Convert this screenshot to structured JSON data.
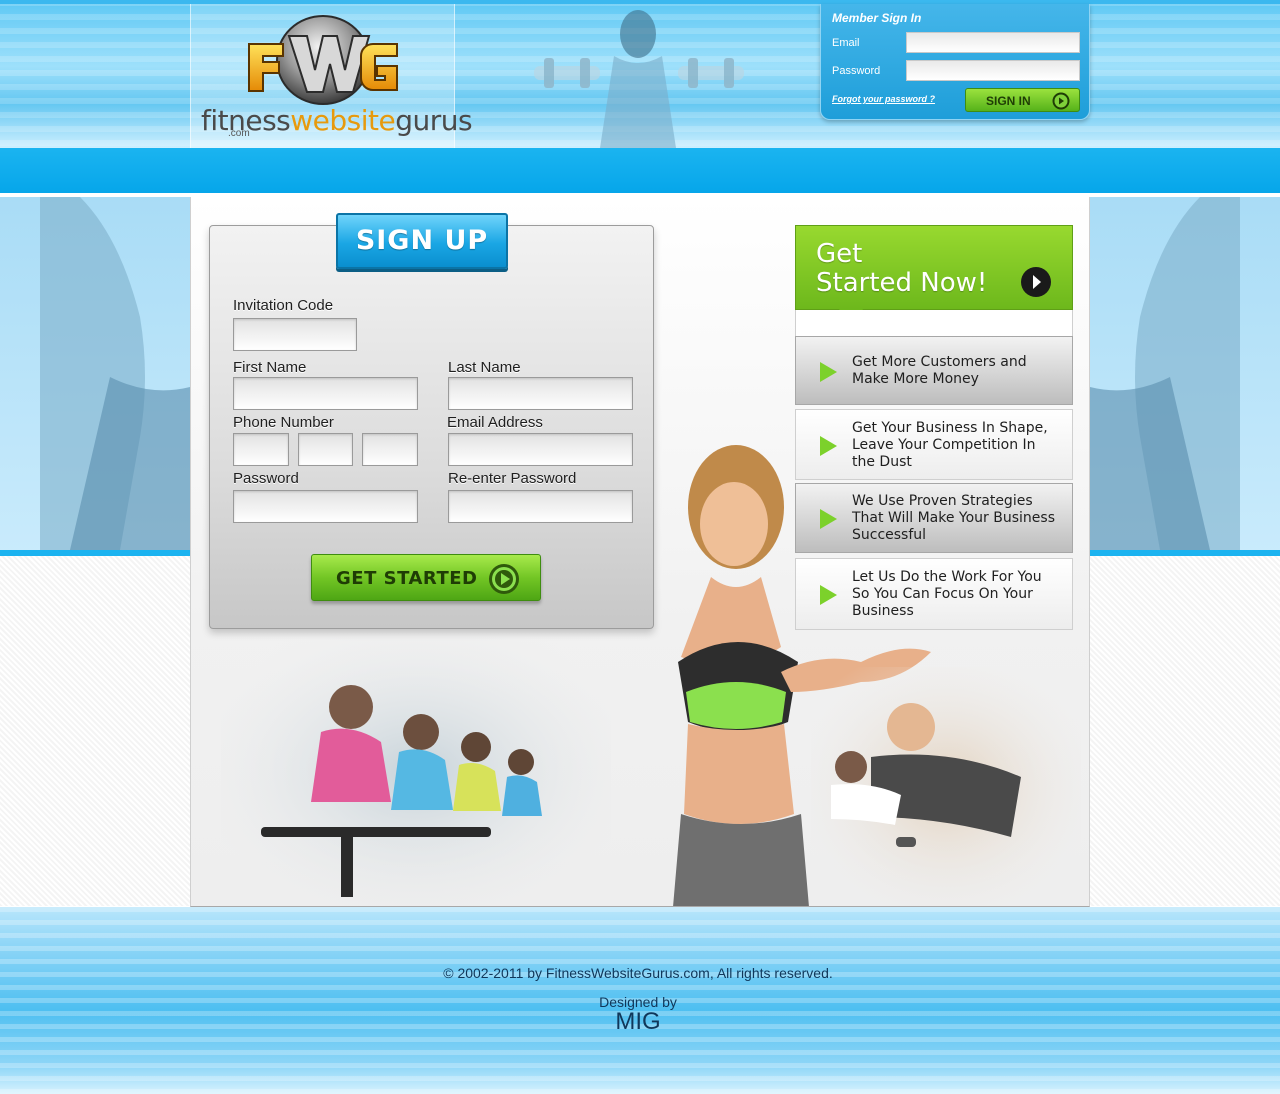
{
  "header": {
    "logo": {
      "emblem_text": "FWG",
      "wordmark_part1": "fitness",
      "wordmark_part2": "website",
      "wordmark_part3": "gurus",
      "tld": ".com"
    },
    "signin": {
      "title": "Member Sign In",
      "email_label": "Email",
      "email_value": "",
      "password_label": "Password",
      "password_value": "",
      "forgot_link": "Forgot your password ?",
      "button_label": "SIGN IN",
      "button_icon": "play-circle-icon"
    }
  },
  "signup": {
    "tab_label": "SIGN UP",
    "fields": {
      "invitation_code_label": "Invitation Code",
      "first_name_label": "First Name",
      "last_name_label": "Last Name",
      "phone_number_label": "Phone Number",
      "email_address_label": "Email Address",
      "password_label": "Password",
      "reenter_password_label": "Re-enter Password"
    },
    "button_label": "GET STARTED",
    "button_icon": "play-circle-icon"
  },
  "get_started_now": {
    "title_line1": "Get",
    "title_line2": "Started Now!",
    "arrow_icon": "arrow-right-circle-icon",
    "items": [
      {
        "text": "Get More Customers and Make More Money",
        "icon": "green-triangle-icon"
      },
      {
        "text": "Get Your Business In Shape, Leave Your Competition In the Dust",
        "icon": "green-triangle-icon"
      },
      {
        "text": "We Use Proven Strategies That Will Make Your Business Successful",
        "icon": "green-triangle-icon"
      },
      {
        "text": "Let Us Do the Work For You So You Can Focus On Your Business",
        "icon": "green-triangle-icon"
      }
    ]
  },
  "footer": {
    "copyright": "© 2002-2011 by FitnessWebsiteGurus.com, All rights reserved.",
    "designed_by": "Designed by",
    "designer": "MIG"
  },
  "colors": {
    "brand_blue": "#06a6ea",
    "accent_green": "#73c625",
    "footer_text": "#10375a"
  }
}
